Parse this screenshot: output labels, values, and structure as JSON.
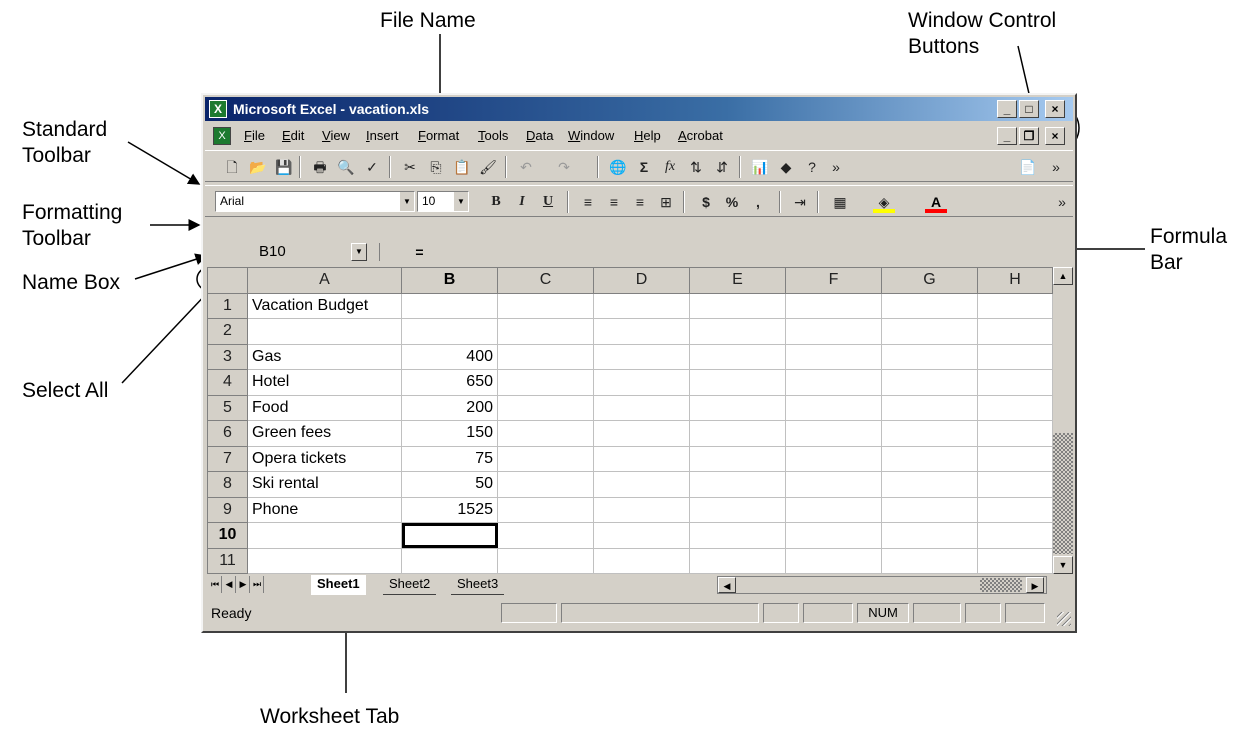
{
  "annotations": {
    "file_name": "File Name",
    "window_controls": "Window Control\nButtons",
    "standard_toolbar": "Standard\nToolbar",
    "formatting_toolbar": "Formatting\nToolbar",
    "formula_bar": "Formula\nBar",
    "name_box": "Name Box",
    "select_all": "Select All",
    "worksheet_tab": "Worksheet Tab"
  },
  "window": {
    "app_name": "Microsoft Excel",
    "separator": " - ",
    "file_name": "vacation.xls",
    "buttons": {
      "minimize": "_",
      "maximize": "□",
      "close": "×",
      "restore": "❐"
    }
  },
  "menu": [
    "File",
    "Edit",
    "View",
    "Insert",
    "Format",
    "Tools",
    "Data",
    "Window",
    "Help",
    "Acrobat"
  ],
  "formatting": {
    "font": "Arial",
    "size": "10",
    "bold": "B",
    "italic": "I",
    "underline": "U",
    "currency": "$",
    "percent": "%",
    "comma": ","
  },
  "standard": {
    "sum": "Σ",
    "fx": "fx"
  },
  "formula_bar": {
    "name_box": "B10",
    "equals": "=",
    "content": ""
  },
  "sheet": {
    "columns": [
      "A",
      "B",
      "C",
      "D",
      "E",
      "F",
      "G",
      "H"
    ],
    "rows": [
      {
        "n": "1",
        "a": "Vacation Budget",
        "b": ""
      },
      {
        "n": "2",
        "a": "",
        "b": ""
      },
      {
        "n": "3",
        "a": "Gas",
        "b": "400"
      },
      {
        "n": "4",
        "a": "Hotel",
        "b": "650"
      },
      {
        "n": "5",
        "a": "Food",
        "b": "200"
      },
      {
        "n": "6",
        "a": "Green fees",
        "b": "150"
      },
      {
        "n": "7",
        "a": "Opera tickets",
        "b": "75"
      },
      {
        "n": "8",
        "a": "Ski rental",
        "b": "50"
      },
      {
        "n": "9",
        "a": "Phone",
        "b": "1525"
      },
      {
        "n": "10",
        "a": "",
        "b": ""
      },
      {
        "n": "11",
        "a": "",
        "b": ""
      }
    ],
    "active_cell": "B10"
  },
  "tabs": [
    "Sheet1",
    "Sheet2",
    "Sheet3"
  ],
  "status": {
    "text": "Ready",
    "num": "NUM"
  },
  "colors": {
    "title_start": "#0a246a",
    "title_end": "#a6caf0",
    "chrome": "#d4d0c8",
    "excel_green": "#1d7a2f"
  }
}
